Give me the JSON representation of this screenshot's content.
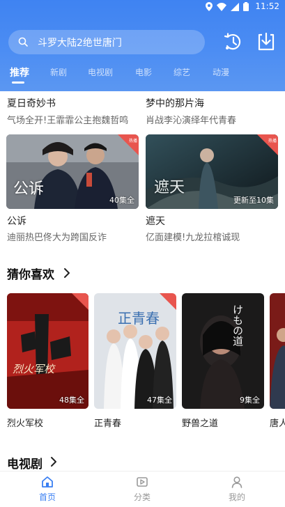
{
  "status": {
    "time": "11:52"
  },
  "search": {
    "placeholder": "斗罗大陆2绝世唐门"
  },
  "tabs": [
    "推荐",
    "新剧",
    "电视剧",
    "电影",
    "综艺",
    "动漫"
  ],
  "top_items": [
    {
      "title": "夏日奇妙书",
      "subtitle": "气场全开!王霏霏公主抱魏哲鸣"
    },
    {
      "title": "梦中的那片海",
      "subtitle": "肖战李沁演绎年代青春"
    }
  ],
  "featured": [
    {
      "title": "公诉",
      "subtitle": "迪丽热巴佟大为跨国反诈",
      "episodes": "40集全",
      "poster_text": "公诉"
    },
    {
      "title": "遮天",
      "subtitle": "亿面建模!九龙拉棺诚现",
      "episodes": "更新至10集",
      "poster_text": "遮天"
    }
  ],
  "section_guess": {
    "title": "猜你喜欢"
  },
  "guess_cards": [
    {
      "title": "烈火军校",
      "episodes": "48集全",
      "poster_text": "烈火军校"
    },
    {
      "title": "正青春",
      "episodes": "47集全",
      "poster_text": "正青春"
    },
    {
      "title": "野兽之道",
      "episodes": "9集全",
      "poster_text": "けもの道"
    },
    {
      "title": "唐人",
      "episodes": "",
      "poster_text": ""
    }
  ],
  "section_tv": {
    "title": "电视剧"
  },
  "badge": {
    "top": "全网",
    "bottom": "独播",
    "corner": "热播"
  },
  "tabbar": [
    {
      "label": "首页",
      "icon": "home-icon",
      "active": true
    },
    {
      "label": "分类",
      "icon": "category-icon",
      "active": false
    },
    {
      "label": "我的",
      "icon": "profile-icon",
      "active": false
    }
  ],
  "colors": {
    "accent": "#3a7ff2",
    "header_top": "#3f83f2",
    "badge": "#e8554e"
  }
}
